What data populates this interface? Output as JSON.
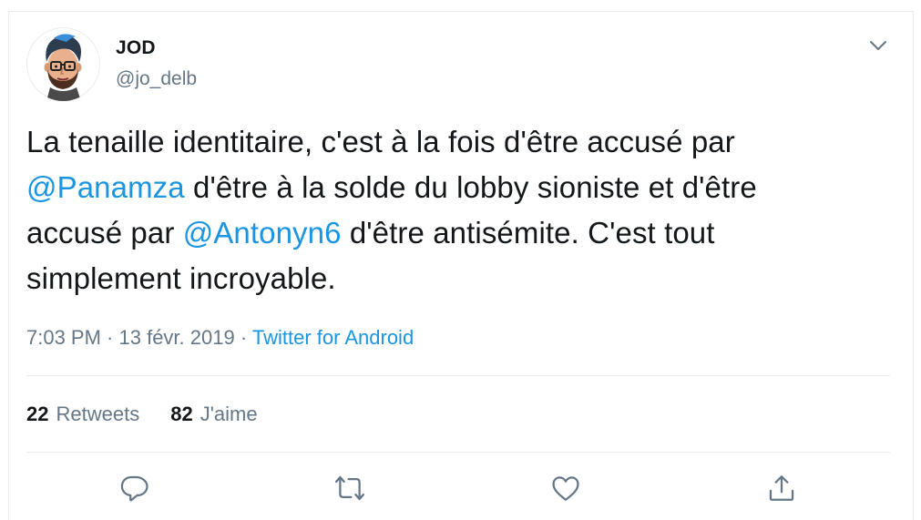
{
  "user": {
    "name": "JOD",
    "handle": "@jo_delb"
  },
  "tweet": {
    "line1": "La tenaille identitaire, c'est à la fois d'être accusé par",
    "mention1": "@Panamza",
    "line2_rest": " d'être à la solde du lobby sioniste et d'être",
    "line3_start": "accusé par ",
    "mention2": "@Antonyn6",
    "line3_rest": " d'être antisémite. C'est tout",
    "line4": "simplement incroyable."
  },
  "meta": {
    "time": "7:03 PM",
    "separator1": " · ",
    "date": "13 févr. 2019",
    "separator2": " · ",
    "source": "Twitter for Android"
  },
  "stats": {
    "retweets_count": "22",
    "retweets_label": "Retweets",
    "likes_count": "82",
    "likes_label": "J'aime"
  },
  "actions": {
    "reply_icon": "reply-icon",
    "retweet_icon": "retweet-icon",
    "like_icon": "heart-icon",
    "share_icon": "share-icon"
  },
  "colors": {
    "link": "#1b95e0",
    "secondary_text": "#657786",
    "icon": "#657786",
    "divider": "#e6ecf0"
  }
}
